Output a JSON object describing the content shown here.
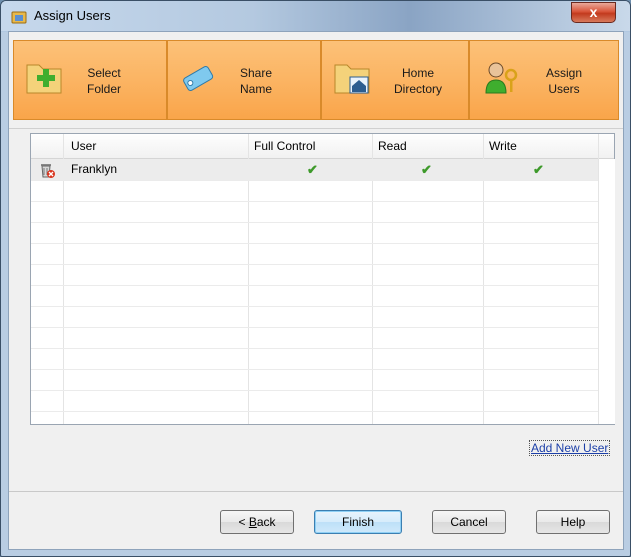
{
  "window": {
    "title": "Assign Users",
    "close_label": "x"
  },
  "steps": [
    {
      "line1": "Select",
      "line2": "Folder",
      "icon": "folder-add-icon"
    },
    {
      "line1": "Share",
      "line2": "Name",
      "icon": "tag-icon"
    },
    {
      "line1": "Home",
      "line2": "Directory",
      "icon": "home-folder-icon"
    },
    {
      "line1": "Assign",
      "line2": "Users",
      "icon": "user-key-icon"
    }
  ],
  "grid": {
    "columns": [
      "User",
      "Full Control",
      "Read",
      "Write"
    ],
    "rows": [
      {
        "user": "Franklyn",
        "full_control": "✔",
        "read": "✔",
        "write": "✔"
      }
    ]
  },
  "add_user_link": "Add New User",
  "buttons": {
    "back_prefix": "< ",
    "back_mnemonic": "B",
    "back_suffix": "ack",
    "finish": "Finish",
    "cancel": "Cancel",
    "help": "Help"
  },
  "colors": {
    "step_orange": "#fbb463",
    "check_green": "#3e9a2b",
    "link_blue": "#1c3fa8"
  }
}
